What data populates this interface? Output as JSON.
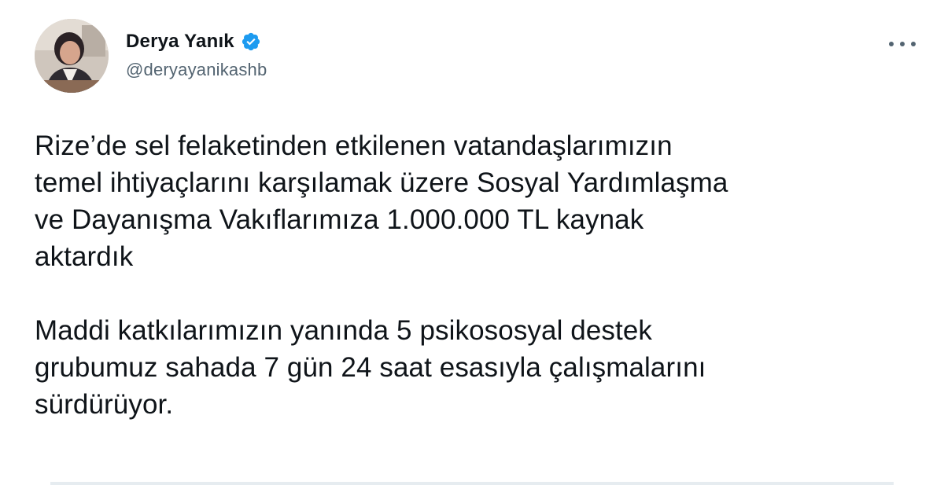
{
  "author": {
    "name": "Derya Yanık",
    "handle": "@deryayanikashb",
    "verified": true,
    "avatar_icon": "profile-photo",
    "verified_icon": "verified-badge-icon",
    "verified_color": "#1d9bf0"
  },
  "menu": {
    "icon": "more-options-icon"
  },
  "tweet": {
    "paragraphs": [
      "Rize’de sel felaketinden etkilenen vatandaşlarımızın\ntemel ihtiyaçlarını karşılamak üzere Sosyal Yardımlaşma\nve Dayanışma Vakıflarımıza 1.000.000 TL kaynak\naktardık",
      "Maddi katkılarımızın yanında 5 psikososyal destek\ngrubumuz sahada 7 gün 24 saat esasıyla çalışmalarını\nsürdürüyor."
    ]
  }
}
